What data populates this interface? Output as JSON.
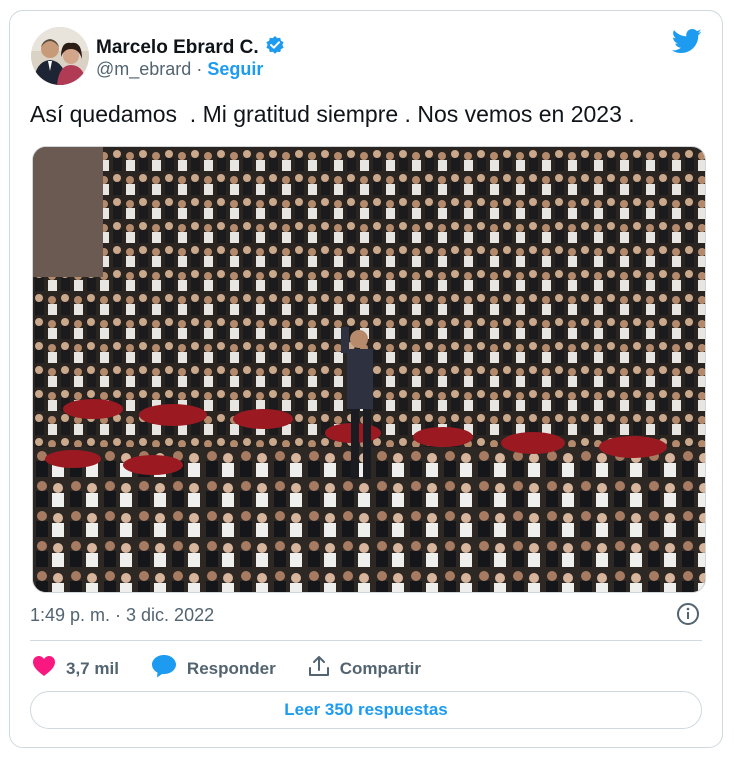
{
  "author": {
    "name": "Marcelo Ebrard C.",
    "handle": "@m_ebrard",
    "separator": "·",
    "follow_label": "Seguir",
    "verified": true
  },
  "tweet": {
    "text": "Así quedamos  . Mi gratitud siempre . Nos vemos en 2023 .",
    "timestamp": "1:49 p. m. · 3 dic. 2022"
  },
  "actions": {
    "likes": "3,7 mil",
    "reply_label": "Responder",
    "share_label": "Compartir"
  },
  "replies_button": "Leer 350 respuestas",
  "colors": {
    "accent": "#1d9bf0",
    "like": "#f91880",
    "text": "#0f1419",
    "muted": "#536471"
  },
  "icons": [
    "twitter-bird-icon",
    "verified-badge-icon",
    "info-icon",
    "heart-icon",
    "reply-bubble-icon",
    "share-icon"
  ]
}
